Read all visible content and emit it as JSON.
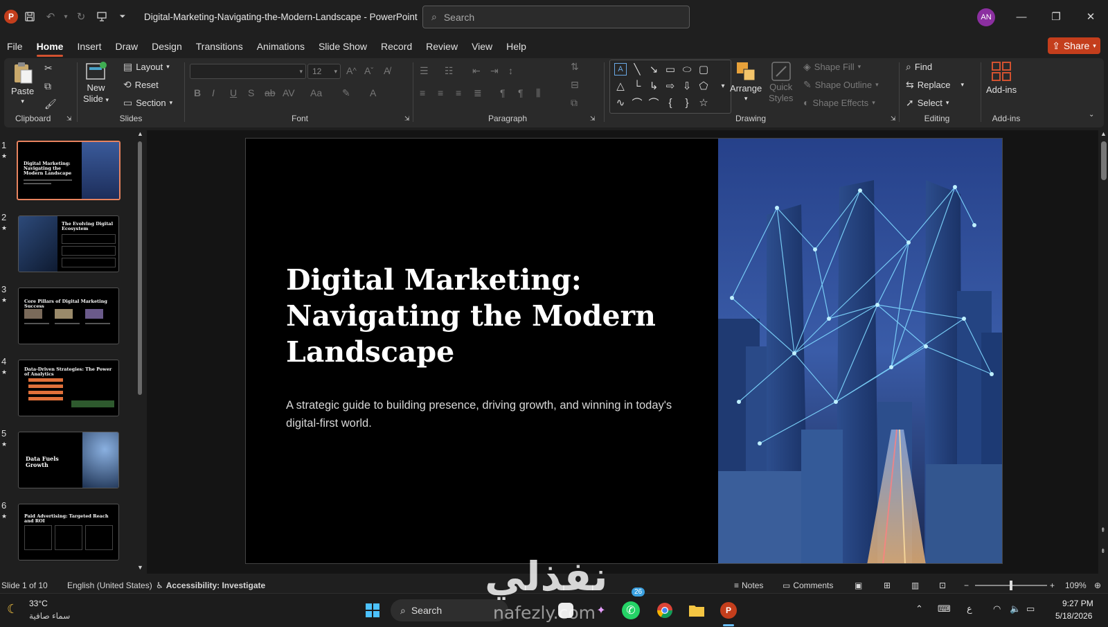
{
  "titlebar": {
    "doc_title": "Digital-Marketing-Navigating-the-Modern-Landscape  -  PowerPoint",
    "search_placeholder": "Search",
    "avatar_initials": "AN"
  },
  "menu": {
    "tabs": [
      "File",
      "Home",
      "Insert",
      "Draw",
      "Design",
      "Transitions",
      "Animations",
      "Slide Show",
      "Record",
      "Review",
      "View",
      "Help"
    ],
    "active": "Home",
    "share_label": "Share"
  },
  "ribbon": {
    "clipboard": {
      "label": "Clipboard",
      "paste": "Paste"
    },
    "slides": {
      "label": "Slides",
      "new_slide_1": "New",
      "new_slide_2": "Slide",
      "layout": "Layout",
      "reset": "Reset",
      "section": "Section"
    },
    "font": {
      "label": "Font",
      "font_size": "12"
    },
    "paragraph": {
      "label": "Paragraph"
    },
    "drawing": {
      "label": "Drawing",
      "arrange": "Arrange",
      "quick_styles_1": "Quick",
      "quick_styles_2": "Styles",
      "shape_fill": "Shape Fill",
      "shape_outline": "Shape Outline",
      "shape_effects": "Shape Effects"
    },
    "editing": {
      "label": "Editing",
      "find": "Find",
      "replace": "Replace",
      "select": "Select"
    },
    "addins": {
      "label": "Add-ins",
      "button": "Add-ins"
    }
  },
  "thumbnails": [
    {
      "num": "1",
      "title": "Digital Marketing: Navigating the Modern Landscape"
    },
    {
      "num": "2",
      "title": "The Evolving Digital Ecosystem"
    },
    {
      "num": "3",
      "title": "Core Pillars of Digital Marketing Success"
    },
    {
      "num": "4",
      "title": "Data-Driven Strategies: The Power of Analytics"
    },
    {
      "num": "5",
      "title": "Data Fuels Growth"
    },
    {
      "num": "6",
      "title": "Paid Advertising: Targeted Reach and ROI"
    }
  ],
  "slide": {
    "title": "Digital Marketing: Navigating the Modern Landscape",
    "subtitle": "A strategic guide to building presence, driving growth, and winning in today's digital-first world."
  },
  "status": {
    "slide_count": "Slide 1 of 10",
    "language": "English (United States)",
    "accessibility": "Accessibility: Investigate",
    "notes": "Notes",
    "comments": "Comments",
    "zoom": "109%"
  },
  "taskbar": {
    "temperature": "33°C",
    "weather": "سماء صافية",
    "search": "Search",
    "badge": "26",
    "input_lang": "ع",
    "time": "9:27 PM",
    "date": "5/18/2026"
  },
  "watermark": {
    "arabic": "نفذلي",
    "latin": "nafezly.com"
  }
}
